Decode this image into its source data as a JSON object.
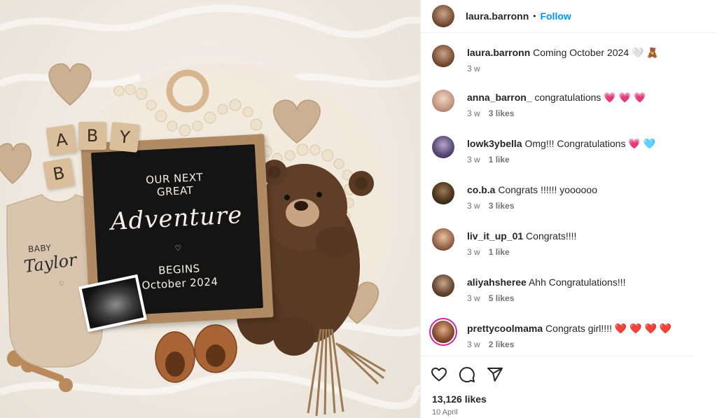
{
  "post": {
    "author": "laura.barronn",
    "follow_label": "Follow",
    "separator": "•",
    "likes_total": "13,126 likes",
    "date": "10 April"
  },
  "photo": {
    "board_line1": "OUR NEXT",
    "board_line2": "GREAT",
    "board_script": "Adventure",
    "board_heart": "♡",
    "board_line3": "BEGINS",
    "board_line4": "October 2024",
    "blocks": [
      "A",
      "B",
      "Y",
      "B"
    ],
    "onesie_line1": "BABY",
    "onesie_line2": "Taylor",
    "onesie_heart": "♡"
  },
  "comments": [
    {
      "user": "laura.barronn",
      "text": "Coming October 2024 🤍 🧸",
      "time": "3 w",
      "likes": ""
    },
    {
      "user": "anna_barron_",
      "text": "congratulations 💗 💗 💗",
      "time": "3 w",
      "likes": "3 likes"
    },
    {
      "user": "lowk3ybella",
      "text": "Omg!!! Congratulations 💗 🩵",
      "time": "3 w",
      "likes": "1 like"
    },
    {
      "user": "co.b.a",
      "text": "Congrats !!!!!! yoooooo",
      "time": "3 w",
      "likes": "3 likes"
    },
    {
      "user": "liv_it_up_01",
      "text": "Congrats!!!!",
      "time": "3 w",
      "likes": "1 like"
    },
    {
      "user": "aliyahsheree",
      "text": "Ahh Congratulations!!!",
      "time": "3 w",
      "likes": "5 likes"
    },
    {
      "user": "prettycoolmama",
      "text": "Congrats girl!!!! ❤️ ❤️ ❤️ ❤️",
      "time": "3 w",
      "likes": "2 likes"
    }
  ],
  "colors": {
    "accent": "#0095f6",
    "muted": "#737373",
    "text": "#262626"
  },
  "icons": [
    "heart-icon",
    "comment-icon",
    "share-icon"
  ]
}
